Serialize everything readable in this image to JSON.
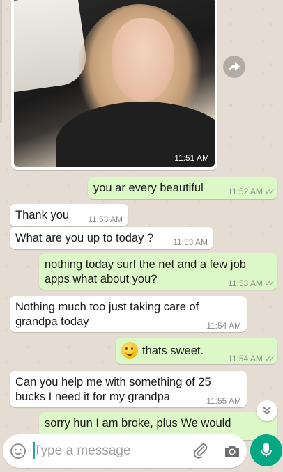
{
  "messages": [
    {
      "id": "photo",
      "direction": "in",
      "type": "image",
      "time": "11:51 AM"
    },
    {
      "id": "m1",
      "direction": "out",
      "text": "you ar every beautiful",
      "time": "11:52 AM",
      "status": "read"
    },
    {
      "id": "m2",
      "direction": "in",
      "text": "Thank you",
      "time": "11:53 AM"
    },
    {
      "id": "m3",
      "direction": "in",
      "text": "What are you up to today ?",
      "time": "11:53 AM"
    },
    {
      "id": "m4",
      "direction": "out",
      "text": "nothing today surf the net and a few job apps what about you?",
      "time": "11:53 AM",
      "status": "read"
    },
    {
      "id": "m5",
      "direction": "in",
      "text": "Nothing much too just taking care of grandpa today",
      "time": "11:54 AM"
    },
    {
      "id": "m6",
      "direction": "out",
      "emoji": "smiling-face",
      "text": "thats sweet.",
      "time": "11:54 AM",
      "status": "read"
    },
    {
      "id": "m7",
      "direction": "in",
      "text": "Can you help me with something of 25 bucks I need it for my grandpa",
      "time": "11:55 AM"
    },
    {
      "id": "m8",
      "direction": "out",
      "text": "sorry hun I am broke, plus We would",
      "status": "partial"
    }
  ],
  "composer": {
    "placeholder": "Type a message",
    "icons": [
      "emoji-icon",
      "attach-icon",
      "camera-icon",
      "mic-icon"
    ]
  },
  "controls": {
    "forward_icon": "forward-icon",
    "scroll_icon": "double-chevron-down-icon"
  },
  "colors": {
    "incoming": "#ffffff",
    "outgoing": "#dcf8c6",
    "accent": "#00a884",
    "wallpaper": "#e5ddd3"
  }
}
